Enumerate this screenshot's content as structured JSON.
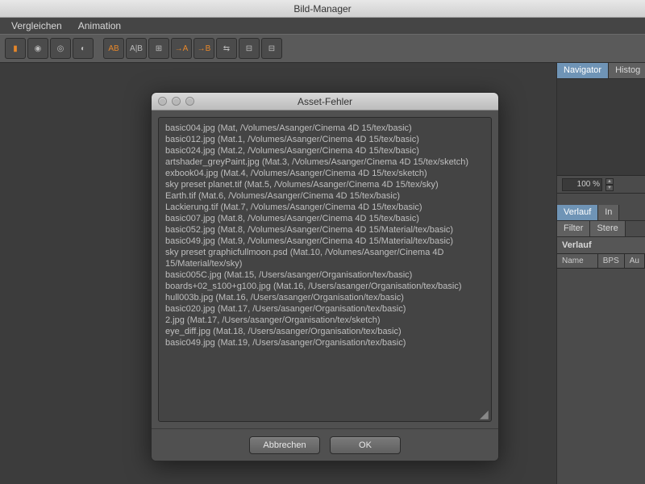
{
  "window": {
    "title": "Bild-Manager"
  },
  "menu": {
    "items": [
      "Vergleichen",
      "Animation"
    ]
  },
  "toolbar": {
    "groups": [
      {
        "icons": [
          "book-orange",
          "eye",
          "eye-dot",
          "match"
        ]
      },
      {
        "icons": [
          "ab-orange",
          "ab-split",
          "ab-gray",
          "arrow-a-orange",
          "arrow-b-orange",
          "ab-scale",
          "grid-a",
          "grid-b"
        ]
      }
    ]
  },
  "sidebar": {
    "top_tabs": [
      {
        "label": "Navigator",
        "active": true
      },
      {
        "label": "Histog",
        "active": false
      }
    ],
    "zoom_value": "100 %",
    "mid_tabs_row1": [
      {
        "label": "Verlauf",
        "active": true
      },
      {
        "label": "In",
        "active": false
      }
    ],
    "mid_tabs_row2": [
      {
        "label": "Filter",
        "active": false
      },
      {
        "label": "Stere",
        "active": false
      }
    ],
    "section_title": "Verlauf",
    "columns": [
      "Name",
      "BPS",
      "Au"
    ]
  },
  "dialog": {
    "title": "Asset-Fehler",
    "errors": [
      "basic004.jpg (Mat, /Volumes/Asanger/Cinema 4D 15/tex/basic)",
      "basic012.jpg (Mat.1, /Volumes/Asanger/Cinema 4D 15/tex/basic)",
      "basic024.jpg (Mat.2, /Volumes/Asanger/Cinema 4D 15/tex/basic)",
      "artshader_greyPaint.jpg (Mat.3, /Volumes/Asanger/Cinema 4D 15/tex/sketch)",
      "exbook04.jpg (Mat.4, /Volumes/Asanger/Cinema 4D 15/tex/sketch)",
      "sky preset planet.tif (Mat.5, /Volumes/Asanger/Cinema 4D 15/tex/sky)",
      "Earth.tif (Mat.6, /Volumes/Asanger/Cinema 4D 15/tex/basic)",
      "Lackierung.tif (Mat.7, /Volumes/Asanger/Cinema 4D 15/tex/basic)",
      "basic007.jpg (Mat.8, /Volumes/Asanger/Cinema 4D 15/tex/basic)",
      "basic052.jpg (Mat.8, /Volumes/Asanger/Cinema 4D 15/Material/tex/basic)",
      "basic049.jpg (Mat.9, /Volumes/Asanger/Cinema 4D 15/Material/tex/basic)",
      "sky preset graphicfullmoon.psd (Mat.10, /Volumes/Asanger/Cinema 4D 15/Material/tex/sky)",
      "basic005C.jpg (Mat.15, /Users/asanger/Organisation/tex/basic)",
      "boards+02_s100+g100.jpg (Mat.16, /Users/asanger/Organisation/tex/basic)",
      "hull003b.jpg (Mat.16, /Users/asanger/Organisation/tex/basic)",
      "basic020.jpg (Mat.17, /Users/asanger/Organisation/tex/basic)",
      "2.jpg (Mat.17, /Users/asanger/Organisation/tex/sketch)",
      "eye_diff.jpg (Mat.18, /Users/asanger/Organisation/tex/basic)",
      "basic049.jpg (Mat.19, /Users/asanger/Organisation/tex/basic)"
    ],
    "cancel_label": "Abbrechen",
    "ok_label": "OK"
  }
}
